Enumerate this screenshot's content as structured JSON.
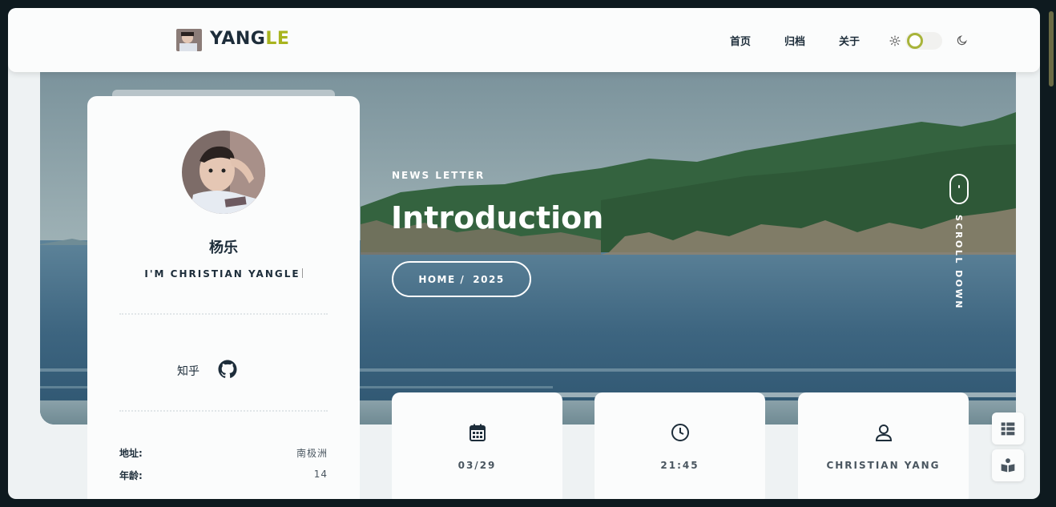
{
  "header": {
    "logo_main": "YANG",
    "logo_accent": "LE",
    "nav": [
      {
        "label": "首页"
      },
      {
        "label": "归档"
      },
      {
        "label": "关于"
      }
    ]
  },
  "hero": {
    "eyebrow": "NEWS LETTER",
    "title": "Introduction",
    "breadcrumb_home": "HOME /",
    "breadcrumb_current": "2025",
    "scroll_label": "SCROLL DOWN"
  },
  "profile": {
    "name": "杨乐",
    "tagline": "I'M CHRISTIAN YANGLE",
    "social_zhihu": "知乎",
    "info": [
      {
        "key": "地址:",
        "value": "南极洲"
      },
      {
        "key": "年龄:",
        "value": "14"
      }
    ]
  },
  "stats": [
    {
      "icon": "calendar-icon",
      "label": "03/29"
    },
    {
      "icon": "clock-icon",
      "label": "21:45"
    },
    {
      "icon": "user-icon",
      "label": "CHRISTIAN YANG"
    }
  ],
  "colors": {
    "accent": "#a8b41e",
    "text": "#1d2d3a",
    "background": "#eef2f3"
  }
}
